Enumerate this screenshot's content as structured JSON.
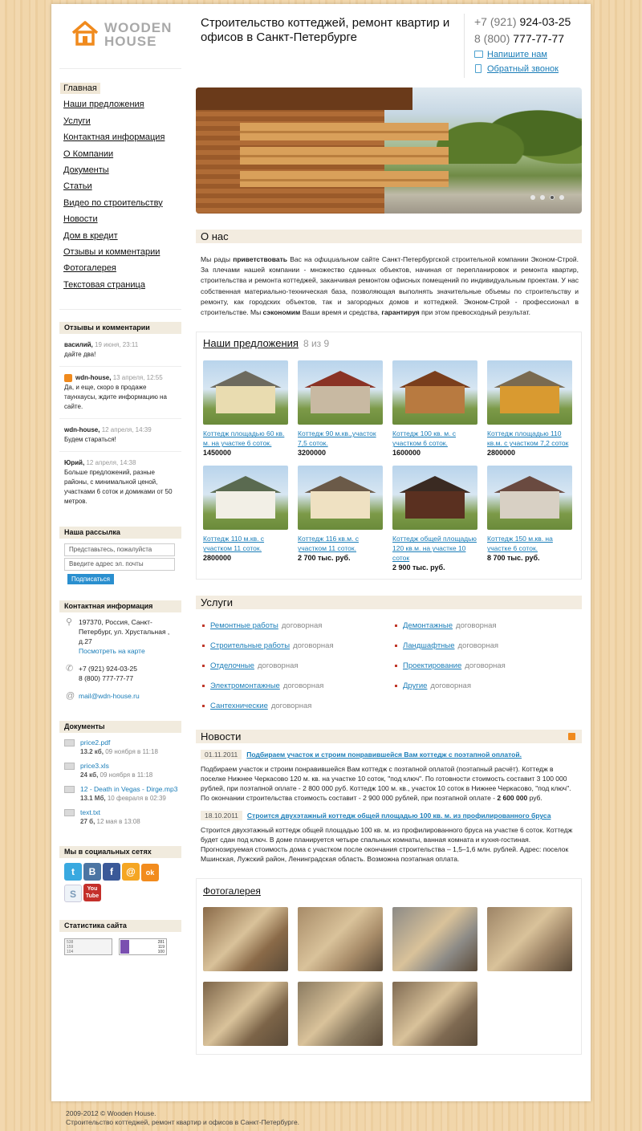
{
  "site": {
    "logo_line1": "WOODEN",
    "logo_line2": "HOUSE",
    "tagline": "Строительство коттеджей, ремонт квартир и офисов в Санкт-Петербурге"
  },
  "contacts": {
    "phone1_code": "+7 (921)",
    "phone1_num": "924-03-25",
    "phone2_code": "8 (800)",
    "phone2_num": "777-77-77",
    "write_us": "Напишите нам",
    "callback": "Обратный звонок"
  },
  "menu": [
    "Главная",
    "Наши предложения",
    "Услуги",
    "Контактная информация",
    "О Компании",
    "Документы",
    "Статьи",
    "Видео по строительству",
    "Новости",
    "Дом в кредит",
    "Отзывы и комментарии",
    "Фотогалерея",
    "Текстовая страница"
  ],
  "reviews": {
    "heading": "Отзывы и комментарии",
    "items": [
      {
        "name": "василий,",
        "date": "19 июня, 23:11",
        "text": "дайте два!"
      },
      {
        "name": "wdn-house,",
        "date": "13 апреля, 12:55",
        "text": "Да, и еще, скоро в продаже таунхаусы, ждите информацию на сайте."
      },
      {
        "name": "wdn-house,",
        "date": "12 апреля, 14:39",
        "text": "Будем стараться!"
      },
      {
        "name": "Юрий,",
        "date": "12 апреля, 14:38",
        "text": "Больше предложений, разные районы, с минимальной ценой, участками 6 соток и домиками от 50 метров."
      }
    ]
  },
  "newsletter": {
    "heading": "Наша рассылка",
    "name_ph": "Представьтесь, пожалуйста",
    "email_ph": "Введите адрес эл. почты",
    "button": "Подписаться"
  },
  "contact_info": {
    "heading": "Контактная информация",
    "address": "197370, Россия, Санкт-Петербург, ул. Хрустальная , д.27",
    "map_link": "Посмотреть на карте",
    "phone1": "+7 (921) 924-03-25",
    "phone2": "8 (800) 777-77-77",
    "email": "mail@wdn-house.ru"
  },
  "documents": {
    "heading": "Документы",
    "items": [
      {
        "name": "price2.pdf",
        "size": "13.2 кб,",
        "date": "09 ноября в 11:18"
      },
      {
        "name": "price3.xls",
        "size": "24 кб,",
        "date": "09 ноября в 11:18"
      },
      {
        "name": "12 - Death in Vegas - Dirge.mp3",
        "size": "13.1 Мб,",
        "date": "10 февраля в 02:39"
      },
      {
        "name": "text.txt",
        "size": "27 б,",
        "date": "12 мая в 13:08"
      }
    ]
  },
  "social": {
    "heading": "Мы в социальных сетях",
    "icons": [
      "twitter-icon",
      "vkontakte-icon",
      "facebook-icon",
      "mailru-icon",
      "odnoklassniki-icon",
      "skype-icon",
      "youtube-icon"
    ],
    "labels": [
      "t",
      "B",
      "f",
      "@",
      "ok",
      "S",
      "You Tube"
    ]
  },
  "stats": {
    "heading": "Статистика сайта",
    "counter1_lines": [
      "538",
      "159",
      "104"
    ],
    "counter2_lines": [
      "281",
      "119",
      "100"
    ]
  },
  "slider": {
    "dots": 4,
    "active": 3
  },
  "about": {
    "heading": "О нас",
    "p1_pre": "Мы рады ",
    "p1_b1": "приветствовать",
    "p1_mid1": " Вас на ",
    "p1_i": "официальном",
    "p1_mid2": " сайте Санкт-Петербургской строительной компании Эконом-Строй. За плечами нашей компании - множество сданных объектов, начиная от перепланировок и ремонта квартир, строительства и ремонта коттеджей, заканчивая ремонтом офисных помещений по индивидуальным проектам. У нас собственная материально-техническая база, позволяющая выполнять значительные объемы по строительству и ремонту, как городских объектов, так и загородных домов и коттеджей. ",
    "p1_link": "Эконом-Строй",
    "p1_mid3": " - профессионал в строительстве. Мы ",
    "p1_b2": "сэкономим",
    "p1_mid4": " Ваши время и средства, ",
    "p1_b3": "гарантируя",
    "p1_end": " при этом превосходный результат."
  },
  "offers": {
    "heading": "Наши предложения",
    "count": "8 из 9",
    "items": [
      {
        "title": "Коттедж площадью 60 кв. м. на участке 6 соток.",
        "price": "1450000"
      },
      {
        "title": "Коттедж 90 м.кв.,участок 7,5 соток.",
        "price": "3200000"
      },
      {
        "title": "Коттедж 100 кв. м. с участком 6 соток.",
        "price": "1600000"
      },
      {
        "title": "Коттедж площадью 110 кв.м. с участком 7,2 соток",
        "price": "2800000"
      },
      {
        "title": "Коттедж 110 м.кв. с участком 11 соток.",
        "price": "2800000"
      },
      {
        "title": "Коттедж 116 кв.м. с участком 11 соток.",
        "price": "2 700 тыс. руб."
      },
      {
        "title": "Коттедж общей площадью 120 кв.м. на участке 10 соток",
        "price": "2 900 тыс. руб."
      },
      {
        "title": "Коттедж 150 м.кв. на участке 6 соток.",
        "price": "8 700 тыс. руб."
      }
    ],
    "colors": [
      [
        "#e9dcb0",
        "#6d6a5e"
      ],
      [
        "#c8b9a2",
        "#8a3325"
      ],
      [
        "#b87a40",
        "#7a3e1c"
      ],
      [
        "#d99a30",
        "#7a6a50"
      ],
      [
        "#f2efe6",
        "#5a6a50"
      ],
      [
        "#efe1c2",
        "#6b5a48"
      ],
      [
        "#5a3020",
        "#3a2a22"
      ],
      [
        "#d8d0c4",
        "#6a4a40"
      ]
    ]
  },
  "services": {
    "heading": "Услуги",
    "items": [
      {
        "name": "Ремонтные работы",
        "price": "договорная"
      },
      {
        "name": "Демонтажные",
        "price": "договорная"
      },
      {
        "name": "Строительные работы",
        "price": "договорная"
      },
      {
        "name": "Ландшафтные",
        "price": "договорная"
      },
      {
        "name": "Отделочные",
        "price": "договорная"
      },
      {
        "name": "Проектирование",
        "price": "договорная"
      },
      {
        "name": "Электромонтажные",
        "price": "договорная"
      },
      {
        "name": "Другие",
        "price": "договорная"
      },
      {
        "name": "Сантехнические",
        "price": "договорная"
      }
    ]
  },
  "news": {
    "heading": "Новости",
    "items": [
      {
        "date": "01.11.2011",
        "title": "Подбираем участок и строим понравившейся Вам коттедж с поэтапной оплатой.",
        "text": "Подбираем участок и строим понравившейся Вам коттедж с поэтапной оплатой (поэтапный расчёт). Коттедж в поселке Нижнее Черкасово 120 м. кв. на участке 10 соток, \"под ключ\". По готовности стоимость составит 3 100 000 рублей, при поэтапной оплате - 2 800 000 руб. Коттедж 100 м. кв., участок 10 соток в Нижнее Черкасово, \"под ключ\". По окончании строительства стоимость составит - 2 900 000 рублей, при поэтапной оплате - ",
        "text_b": "2 600 000",
        "text_end": " руб."
      },
      {
        "date": "18.10.2011",
        "title": "Строится двухэтажный коттедж общей площадью 100 кв. м. из профилированного бруса",
        "text": "Строится двухэтажный коттедж общей площадью 100 кв. м. из профилированного бруса на участке 6 соток. Коттедж будет сдан под ключ. В доме планируется четыре спальных комнаты, ванная комната и кухня-гостиная. Прогнозируемая стоимость дома с участком после окончания строительства – 1,5–1,6 млн. рублей. Адрес: поселок Мшинская, Лужский район, Ленинградская область. Возможна поэтапная оплата.",
        "text_b": "",
        "text_end": ""
      }
    ]
  },
  "gallery": {
    "heading": "Фотогалерея",
    "photos": 7,
    "colors": [
      "#8a6a48",
      "#a78b68",
      "#8c8a86",
      "#9d8466",
      "#7c6448",
      "#8a7a60",
      "#7f6a52"
    ]
  },
  "footer": {
    "line1": "2009-2012 © Wooden House.",
    "line2": "Строительство коттеджей, ремонт квартир и офисов в Санкт-Петербурге."
  }
}
